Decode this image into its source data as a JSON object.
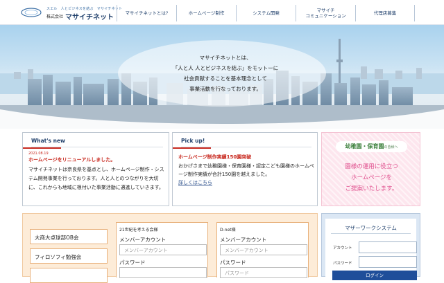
{
  "header": {
    "logo_tagline": "スエル　人とビジネスを結ぶ　マサイチネット",
    "logo_corp": "株式会社",
    "logo_name": "マサイチネット",
    "nav": [
      {
        "label": "マサイチネットとは?"
      },
      {
        "label": "ホームページ制作"
      },
      {
        "label": "システム開発"
      },
      {
        "label_line1": "マサイチ",
        "label_line2": "コミュニケーション"
      },
      {
        "label": "代理店募集"
      }
    ]
  },
  "hero": {
    "lines": [
      "マサイチネットとは、",
      "「人と人 人とビジネスを結ぶ」をモットーに",
      "社会貢献することを基本理念として",
      "事業活動を行なっております。"
    ]
  },
  "whats_new": {
    "heading": "What's new",
    "date": "2021.08.19",
    "title": "ホームページをリニューアルしました。",
    "body": "マサイチネットは奈良県を基点とし、ホームページ制作・システム開発事業を行っております。人と人とのつながりを大切に、これからも地域に根付いた事業活動に邁進していきます。"
  },
  "pickup": {
    "heading": "Pick up!",
    "title": "ホームページ制作実績150園突破",
    "body": "おかげさまで幼稚園様・保育園様・認定こども園様のホームページ制作実績が合計150園を越えました。",
    "link": "詳しくはこちら"
  },
  "banner": {
    "ribbon": "幼稚園・保育園",
    "ribbon_suffix": "の皆様へ",
    "line1": "園様の運用に役立つ",
    "line2": "ホームページを",
    "line3": "ご提案いたします。"
  },
  "clubs": {
    "items": [
      "大商大卓球部OB会",
      "フィロソフィ勉強会"
    ],
    "panel1": {
      "title": "21世紀を考える会様",
      "account_label": "メンバーアカウント",
      "account_placeholder": "メンバーアカウント",
      "password_label": "パスワード"
    },
    "panel2": {
      "title": "D-net様",
      "account_label": "メンバーアカウント",
      "account_placeholder": "メンバーアカウント",
      "password_label": "パスワード",
      "password_placeholder": "パスワード"
    }
  },
  "mother_work": {
    "title": "マザーワークシステム",
    "account_label": "アカウント",
    "password_label": "パスワード",
    "login": "ログイン"
  },
  "colors": {
    "navy": "#1f3f6b",
    "accent_red": "#c8281e",
    "banner_pink": "#e0508e",
    "login_blue": "#1f4e9a"
  }
}
